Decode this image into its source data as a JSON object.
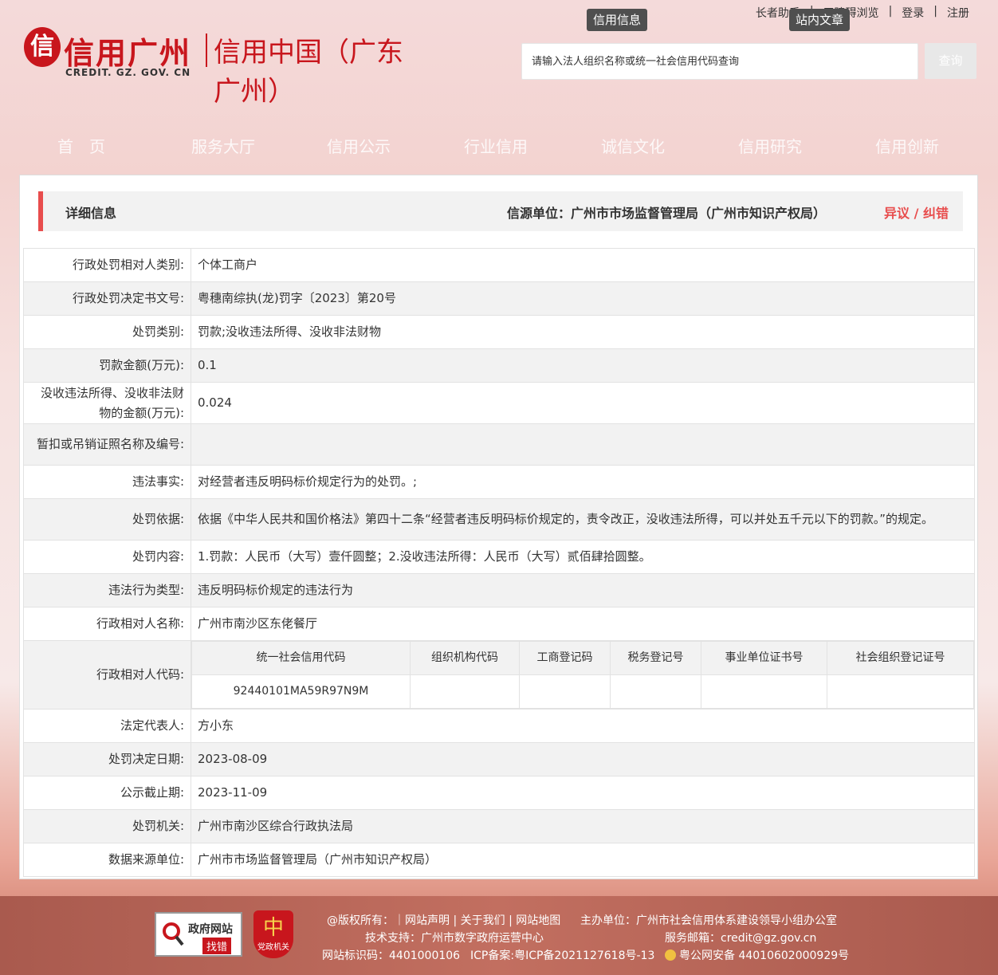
{
  "header": {
    "logo_mark": "信",
    "logo_main": "信用广州",
    "logo_sub": "CREDIT. GZ. GOV. CN",
    "logo_right": "信用中国（广东广州）",
    "top_links": [
      "长者助手",
      "无障碍浏览",
      "登录",
      "注册"
    ],
    "tab_info": "信用信息",
    "tab_article": "站内文章",
    "search_placeholder": "请输入法人组织名称或统一社会信用代码查询",
    "search_button": "查询"
  },
  "nav": [
    "首　页",
    "服务大厅",
    "信用公示",
    "行业信用",
    "诚信文化",
    "信用研究",
    "信用创新"
  ],
  "panel": {
    "title": "详细信息",
    "source": "信源单位：广州市市场监督管理局（广州市知识产权局）",
    "objection": "异议 / 纠错"
  },
  "rows": {
    "subject_type": {
      "label": "行政处罚相对人类别:",
      "value": "个体工商户"
    },
    "doc_no": {
      "label": "行政处罚决定书文号:",
      "value": "粤穗南综执(龙)罚字〔2023〕第20号"
    },
    "penalty_type": {
      "label": "处罚类别:",
      "value": "罚款;没收违法所得、没收非法财物"
    },
    "fine": {
      "label": "罚款金额(万元):",
      "value": "0.1"
    },
    "confiscation": {
      "label": "没收违法所得、没收非法财物的金额(万元):",
      "value": "0.024"
    },
    "license": {
      "label": "暂扣或吊销证照名称及编号:",
      "value": ""
    },
    "facts": {
      "label": "违法事实:",
      "value": "对经营者违反明码标价规定行为的处罚。;"
    },
    "basis": {
      "label": "处罚依据:",
      "value": "依据《中华人民共和国价格法》第四十二条“经营者违反明码标价规定的，责令改正，没收违法所得，可以并处五千元以下的罚款。”的规定。"
    },
    "content": {
      "label": "处罚内容:",
      "value": "1.罚款：人民币（大写）壹仟圆整；2.没收违法所得：人民币（大写）贰佰肆拾圆整。"
    },
    "behavior_type": {
      "label": "违法行为类型:",
      "value": "违反明码标价规定的违法行为"
    },
    "subject_name": {
      "label": "行政相对人名称:",
      "value": "广州市南沙区东佬餐厅"
    },
    "subject_code": {
      "label": "行政相对人代码:",
      "headers": [
        "统一社会信用代码",
        "组织机构代码",
        "工商登记码",
        "税务登记号",
        "事业单位证书号",
        "社会组织登记证号"
      ],
      "values": [
        "92440101MA59R97N9M",
        "",
        "",
        "",
        "",
        ""
      ]
    },
    "legal_rep": {
      "label": "法定代表人:",
      "value": "方小东"
    },
    "decision_date": {
      "label": "处罚决定日期:",
      "value": "2023-08-09"
    },
    "expiry_date": {
      "label": "公示截止期:",
      "value": "2023-11-09"
    },
    "authority": {
      "label": "处罚机关:",
      "value": "广州市南沙区综合行政执法局"
    },
    "data_source": {
      "label": "数据来源单位:",
      "value": "广州市市场监督管理局（广州市知识产权局）"
    }
  },
  "footer": {
    "gov_badge_t1": "政府网站",
    "gov_badge_t2": "找错",
    "party_badge_icon": "中",
    "party_badge_text": "党政机关",
    "line1a": "@版权所有：｜网站声明 | 关于我们 | 网站地图",
    "line1b": "主办单位：广州市社会信用体系建设领导小组办公室",
    "line2a": "技术支持：广州市数字政府运营中心",
    "line2b": "服务邮箱：credit@gz.gov.cn",
    "line3a": "网站标识码：4401000106",
    "line3b": "ICP备案:粤ICP备2021127618号-13",
    "line3c": "粤公网安备 44010602000929号"
  },
  "colors": {
    "brand_red": "#c8161d",
    "accent_red": "#e84d4d",
    "footer_bg": "#b66456"
  }
}
